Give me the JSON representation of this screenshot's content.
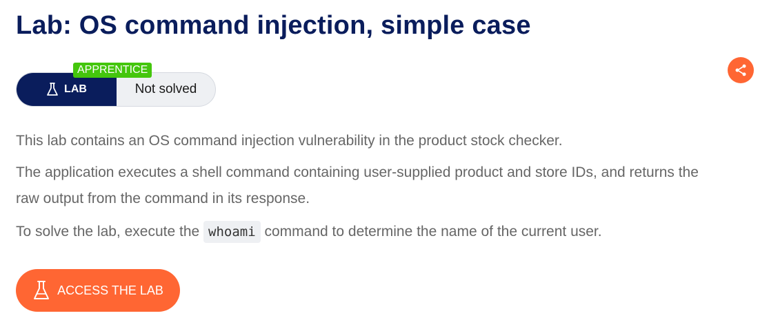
{
  "header": {
    "title": "Lab: OS command injection, simple case"
  },
  "share": {
    "icon": "share-icon"
  },
  "lab_badge": {
    "level": "APPRENTICE",
    "type_label": "LAB",
    "type_icon": "flask-icon",
    "status": "Not solved"
  },
  "description": {
    "p1": "This lab contains an OS command injection vulnerability in the product stock checker.",
    "p2_line1": "The application executes a shell command containing user-supplied product and store IDs, and returns the",
    "p2_line2": "raw output from the command in its response.",
    "p3_before": "To solve the lab, execute the",
    "p3_code": "whoami",
    "p3_after": "command to determine the name of the current user."
  },
  "access_button": {
    "label": "ACCESS THE LAB",
    "icon": "flask-icon"
  },
  "colors": {
    "title": "#0a1d5c",
    "accent": "#ff6633",
    "level_green": "#44c60d",
    "pill_dark": "#0a1d5c",
    "body_text": "#666666"
  }
}
